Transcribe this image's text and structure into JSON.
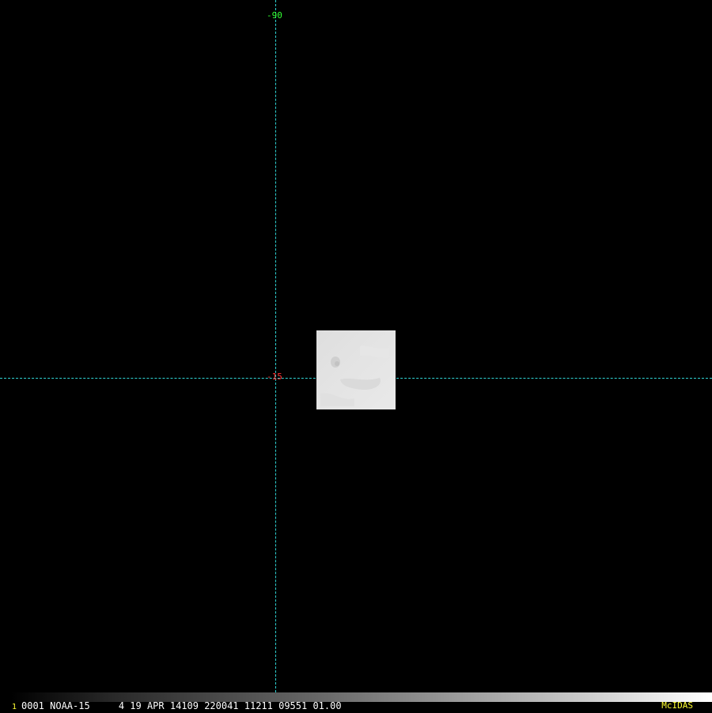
{
  "display": {
    "background": "#000000",
    "gridline_color": "#2fd3d3",
    "grid_labels": {
      "longitude": {
        "text": "-90",
        "color": "#33ff33"
      },
      "latitude": {
        "text": "-15",
        "color": "#ff3333"
      }
    }
  },
  "image_patch": {
    "description_color": "#e2e2e2"
  },
  "status_bar": {
    "frame_number": "1",
    "info": "0001 NOAA-15     4 19 APR 14109 220041 11211 09551 01.00",
    "brand": "McIDAS",
    "frame_color": "#ffff33",
    "brand_color": "#ffff33"
  }
}
